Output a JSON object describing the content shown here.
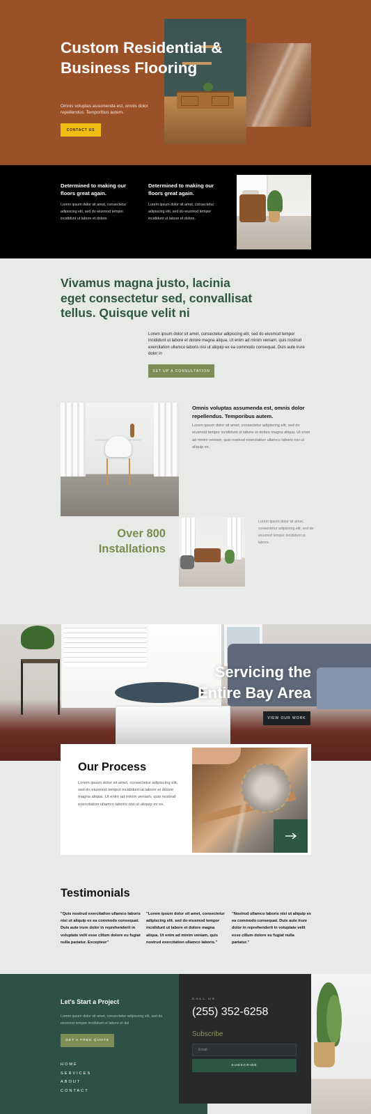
{
  "hero": {
    "title": "Custom Residential & Business Flooring",
    "subtitle": "Omnis voluptas assumenda est, omnis dolor repellendus. Temporibus autem.",
    "cta": "CONTACT US"
  },
  "band": {
    "columns": [
      {
        "heading": "Determined to making our floors great again.",
        "text": "Lorem ipsum dolor sit amet, consectetur adipiscing elit, sed do eiusmod tempor incididunt ut labore et dolore."
      },
      {
        "heading": "Determined to making our floors great again.",
        "text": "Lorem ipsum dolor sit amet, consectetur adipiscing elit, sed do eiusmod tempor incididunt ut labore et dolore."
      }
    ]
  },
  "intro": {
    "headline": "Vivamus magna justo, lacinia eget consectetur sed, convallisat tellus. Quisque velit ni",
    "paragraph": "Lorem ipsum dolor sit amet, consectetur adipiscing elit, sed do eiusmod tempor incididunt ut labore et dolore magna aliqua. Ut enim ad minim veniam, quis nostrud exercitation ullamco laboris nisi ut aliquip ex ea commodo consequat. Duis aute irure dolor in",
    "cta": "SET UP A CONSULTATION",
    "feature_heading": "Omnis voluptas assumenda est, omnis dolor repellendus. Temporibus autem.",
    "feature_text": "Lorem ipsum dolor sit amet, consectetur adipiscing elit, sed do eiusmod tempor incididunt ut labore et dolore magna aliqua. Ut enim ad minim veniam, quis nostrud exercitation ullamco laboris nisi ut aliquip ex.",
    "stat": "Over 800 Installations",
    "side_text": "Lorem ipsum dolor sit amet, consectetur adipiscing elit, sed do eiusmod tempor incididunt ut labore."
  },
  "bay": {
    "title": "Servicing the Entire Bay Area",
    "cta": "VIEW OUR WORK"
  },
  "process": {
    "title": "Our Process",
    "text": "Lorem ipsum dolor sit amet, consectetur adipiscing elit, sed do eiusmod tempor incididunt ut labore et dolore magna aliqua. Ut enim ad minim veniam, quis nostrud exercitation ullamco laboris nisi ut aliquip ex ex.",
    "arrow_icon": "arrow-right-icon"
  },
  "testimonials": {
    "title": "Testimonials",
    "quotes": [
      "\"Quis nostrud exercitation ullamco laboris nisi ut aliquip ex ea commodo consequat. Duis aute irure dolor in reprehenderit in voluptate velit esse cillum dolore eu fugiat nulla pariatur. Excepteur\"",
      "\"Lorem ipsum dolor sit amet, consectetur adipiscing elit. sed do eiusmod tempor incididunt ut labore et dolore magna aliqua. Ut enim ad minim veniam, quis nostrud exercitation ullamco laboris.\"",
      "\"Nostrud ullamco laboris nisi ut aliquip ex ea commodo consequat. Duis aute irure dolor in reprehenderit in voluptate velit esse cillum dolore eu fugiat nulla pariatur.\""
    ]
  },
  "footer": {
    "title": "Let's Start a Project",
    "text": "Lorem ipsum dolor sit amet, consectetur adipiscing elit, sed do eiusmod tempor incididunt ut labore et dol",
    "cta": "GET A FREE QUOTE",
    "nav": [
      "HOME",
      "SERVICES",
      "ABOUT",
      "CONTACT"
    ],
    "call_label": "CALL US",
    "phone": "(255) 352-6258",
    "subscribe_title": "Subscribe",
    "email_placeholder": "Email",
    "subscribe_button": "SUBSCRIBE"
  },
  "colors": {
    "hero_bg": "#9a5128",
    "accent_yellow": "#f2bd12",
    "brand_green": "#2d5245",
    "olive": "#7e8c55",
    "dark": "#27292b"
  }
}
